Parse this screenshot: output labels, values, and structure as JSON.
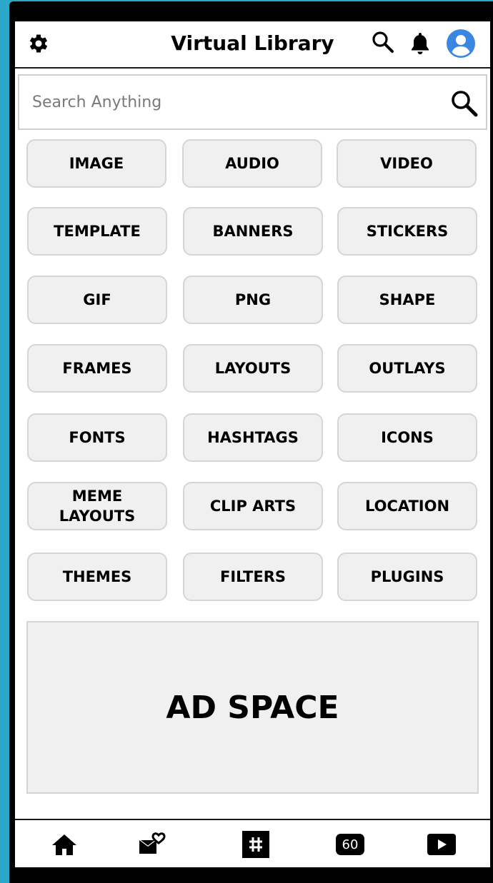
{
  "header": {
    "title": "Virtual Library",
    "icons": [
      "gear-icon",
      "search-icon",
      "bell-icon",
      "user-avatar-icon"
    ],
    "avatar_color": "#3b86e0"
  },
  "search": {
    "placeholder": "Search Anything"
  },
  "categories": [
    "IMAGE",
    "AUDIO",
    "VIDEO",
    "TEMPLATE",
    "BANNERS",
    "STICKERS",
    "GIF",
    "PNG",
    "SHAPE",
    "FRAMES",
    "LAYOUTS",
    "OUTLAYS",
    "FONTS",
    "HASHTAGS",
    "ICONS",
    "MEME LAYOUTS",
    "CLIP ARTS",
    "LOCATION",
    "THEMES",
    "FILTERS",
    "PLUGINS"
  ],
  "ad": {
    "label": "AD SPACE"
  },
  "bottom_nav": {
    "items": [
      "home-icon",
      "mail-heart-icon",
      "hashtag-icon",
      "sixty-badge",
      "play-icon"
    ],
    "badge_label": "60"
  },
  "colors": {
    "page_background": "#2aa7c9",
    "button_background": "#f0f0f0",
    "button_border": "#d5d5d5"
  }
}
